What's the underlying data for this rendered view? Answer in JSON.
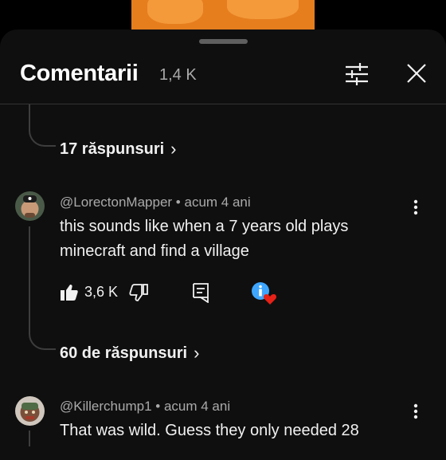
{
  "panel": {
    "title": "Comentarii",
    "count": "1,4 K",
    "filter_icon": "sliders-icon",
    "close_icon": "close-icon"
  },
  "replies_prev": {
    "label": "17 răspunsuri",
    "chevron": "›"
  },
  "comments": [
    {
      "handle": "@LorectonMapper",
      "time": "acum 4 ani",
      "text_line1": "this sounds like when a 7 years old plays",
      "text_line2": "minecraft and find a village",
      "likes": "3,6 K",
      "replies_label": "60 de răspunsuri"
    },
    {
      "handle": "@Killerchump1",
      "time": "acum 4 ani",
      "text_line1": "That was wild. Guess they only needed 28"
    }
  ],
  "separator": "•",
  "colors": {
    "background": "#0f0f0f",
    "text_primary": "#f1f1f1",
    "text_secondary": "#aaaaaa",
    "info_badge": "#3ea6ff",
    "heart": "#e62117",
    "video_accent": "#e67e1e"
  }
}
